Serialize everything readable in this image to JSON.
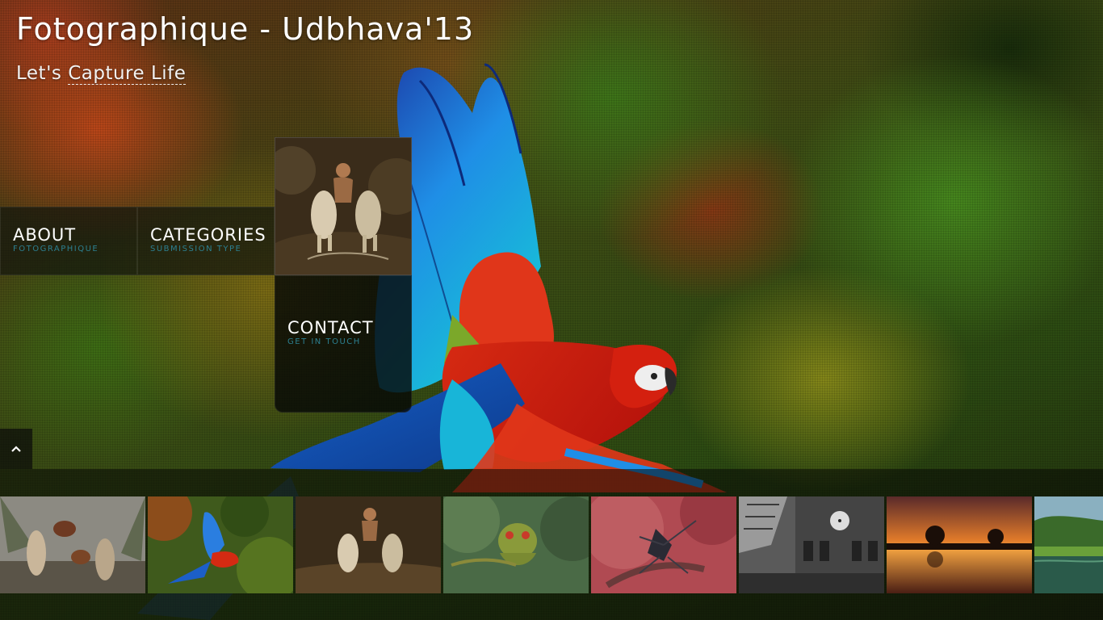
{
  "header": {
    "title": "Fotographique - Udbhava'13",
    "tagline_prefix": "Let's",
    "tagline_link": "Capture Life"
  },
  "tiles": {
    "about": {
      "title": "ABOUT",
      "subtitle": "FOTOGRAPHIQUE"
    },
    "categories": {
      "title": "CATEGORIES",
      "subtitle": "SUBMISSION TYPE"
    },
    "contact": {
      "title": "CONTACT",
      "subtitle": "GET IN TOUCH"
    },
    "featured_photo": {
      "subject": "bull-race-photo"
    }
  },
  "scroll_up": {
    "icon": "chevron-up-icon"
  },
  "gallery": {
    "thumbnails": [
      {
        "subject": "rooster-fight-photo"
      },
      {
        "subject": "macaw-flight-photo"
      },
      {
        "subject": "bull-race-photo"
      },
      {
        "subject": "lizard-closeup-photo"
      },
      {
        "subject": "mantis-macro-photo"
      },
      {
        "subject": "clock-tower-bw-photo"
      },
      {
        "subject": "sunset-trees-photo"
      },
      {
        "subject": "green-lake-photo"
      }
    ]
  },
  "colors": {
    "tile_subtitle": "#2c7f90",
    "tile_background": "#14160e",
    "text": "#ffffff"
  }
}
